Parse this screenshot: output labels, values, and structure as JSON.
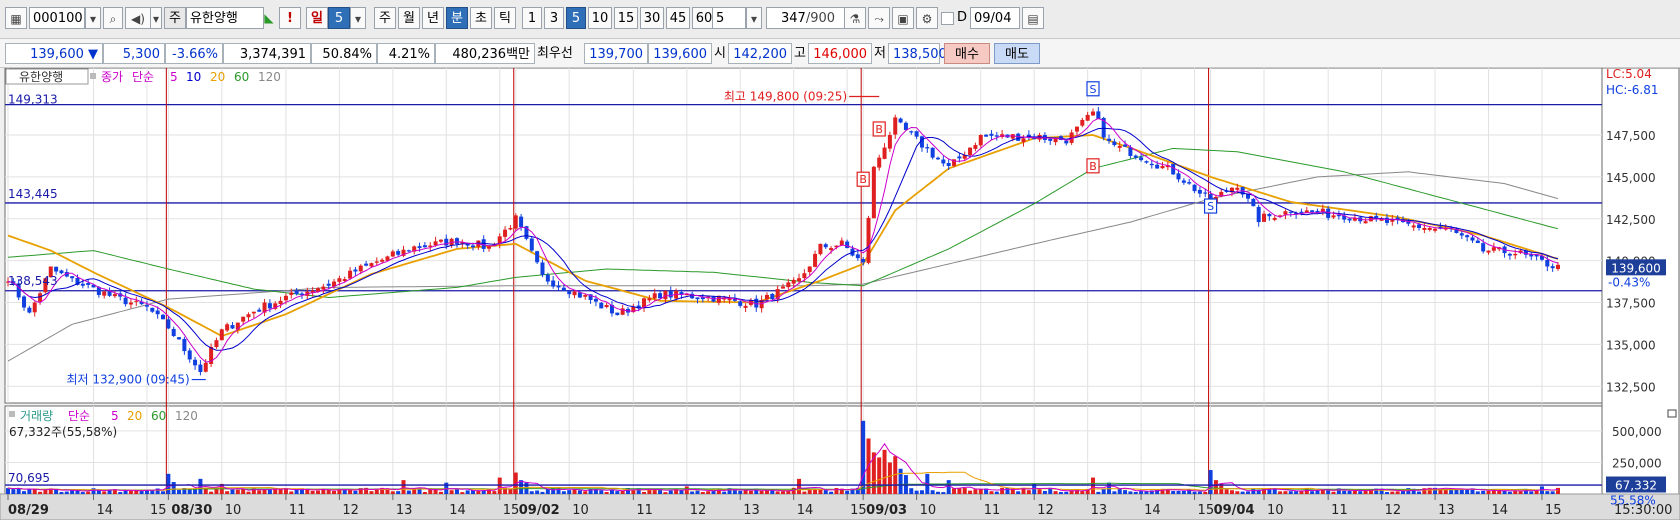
{
  "toolbar": {
    "code": "000100",
    "type_badge": "주",
    "stock_name": "유한양행",
    "alert_label": "!",
    "day_label": "일",
    "day_value": "5",
    "week_label": "주",
    "month_label": "월",
    "year_label": "년",
    "minute_label": "분",
    "second_label": "초",
    "tick_label": "틱",
    "intervals": [
      "1",
      "3",
      "5",
      "10",
      "15",
      "30",
      "45",
      "60"
    ],
    "selected_interval": "5",
    "interval_value": "5",
    "count_value": "347",
    "count_total": "/900",
    "d_label": "D",
    "date_value": "09/04"
  },
  "quote": {
    "price": "139,600 ▼",
    "change": "5,300",
    "change_pct": "-3.66%",
    "volume": "3,374,391",
    "volume_ratio": "50.84%",
    "turnover": "4.21%",
    "amount": "480,236백만",
    "best_label": "최우선",
    "best_ask": "139,700",
    "best_bid": "139,600",
    "open_label": "시",
    "open_value": "142,200",
    "high_label": "고",
    "high_value": "146,000",
    "low_label": "저",
    "low_value": "138,500",
    "buy_button": "매수",
    "sell_button": "매도"
  },
  "colors": {
    "up": "#e02020",
    "down": "#1040e0",
    "ma5": "#cc00cc",
    "ma10": "#0000cc",
    "ma20": "#e8a000",
    "ma60": "#2a9a2a",
    "ma120": "#888888",
    "ref_line": "#1a1aa8",
    "day_line": "#c00000"
  },
  "chart_data": [
    {
      "type": "candlestick",
      "legend": {
        "name": "유한양행",
        "series": "종가",
        "method": "단순",
        "periods": [
          "5",
          "10",
          "20",
          "60",
          "120"
        ]
      },
      "ylim": [
        131500,
        151500
      ],
      "y_ticks": [
        "147,500",
        "145,000",
        "142,500",
        "140,000",
        "137,500",
        "135,000",
        "132,500"
      ],
      "y_tick_values": [
        147500,
        145000,
        142500,
        140000,
        137500,
        135000,
        132500
      ],
      "ref_lines": [
        {
          "label": "149,313",
          "value": 149313
        },
        {
          "label": "143,445",
          "value": 143445
        },
        {
          "label": "138,543",
          "value": 138200
        }
      ],
      "annotations": {
        "high": "최고 149,800 (09:25)",
        "high_value": 149800,
        "low": "최저 132,900 (09:45)",
        "low_value": 132900,
        "lc": "LC:5.04",
        "hc": "HC:-6.81",
        "current_price": "139,600",
        "current_value": 139600,
        "current_pct": "-0.43%"
      },
      "signals": [
        {
          "label": "B",
          "index": 160,
          "value": 144800
        },
        {
          "label": "B",
          "index": 163,
          "value": 147800
        },
        {
          "label": "S",
          "index": 203,
          "value": 150200
        },
        {
          "label": "B",
          "index": 203,
          "value": 145600
        },
        {
          "label": "S",
          "index": 225,
          "value": 143200
        }
      ],
      "day_break_indices": [
        30,
        95,
        160,
        225
      ],
      "time_labels": [
        "08/29",
        "14",
        "15",
        "08/30",
        "10",
        "11",
        "12",
        "13",
        "14",
        "15",
        "09/02",
        "10",
        "11",
        "12",
        "13",
        "14",
        "15",
        "09/03",
        "10",
        "11",
        "12",
        "13",
        "14",
        "15",
        "09/04",
        "10",
        "11",
        "12",
        "13",
        "14",
        "15"
      ],
      "time_label_indices": [
        0,
        16,
        26,
        30,
        40,
        52,
        62,
        72,
        82,
        92,
        95,
        105,
        117,
        127,
        137,
        147,
        157,
        160,
        170,
        182,
        192,
        202,
        212,
        222,
        225,
        235,
        247,
        257,
        267,
        277,
        287
      ],
      "time_label_dates": [
        true,
        false,
        false,
        true,
        false,
        false,
        false,
        false,
        false,
        false,
        true,
        false,
        false,
        false,
        false,
        false,
        false,
        true,
        false,
        false,
        false,
        false,
        false,
        false,
        true,
        false,
        false,
        false,
        false,
        false,
        false
      ],
      "time_end_label": "15:30:00",
      "close_anchors": [
        [
          0,
          139000
        ],
        [
          4,
          136800
        ],
        [
          8,
          139500
        ],
        [
          12,
          138800
        ],
        [
          20,
          137800
        ],
        [
          26,
          137200
        ],
        [
          30,
          136000
        ],
        [
          36,
          133400
        ],
        [
          40,
          135800
        ],
        [
          46,
          137000
        ],
        [
          52,
          137800
        ],
        [
          60,
          138600
        ],
        [
          68,
          139800
        ],
        [
          76,
          140800
        ],
        [
          84,
          141200
        ],
        [
          90,
          140800
        ],
        [
          95,
          142500
        ],
        [
          100,
          139000
        ],
        [
          108,
          137800
        ],
        [
          114,
          136800
        ],
        [
          122,
          138000
        ],
        [
          132,
          137800
        ],
        [
          140,
          137400
        ],
        [
          148,
          138800
        ],
        [
          152,
          140800
        ],
        [
          156,
          141000
        ],
        [
          160,
          139800
        ],
        [
          162,
          145500
        ],
        [
          166,
          148300
        ],
        [
          172,
          146600
        ],
        [
          176,
          145500
        ],
        [
          182,
          147400
        ],
        [
          192,
          147400
        ],
        [
          198,
          147200
        ],
        [
          203,
          148800
        ],
        [
          206,
          147000
        ],
        [
          212,
          146200
        ],
        [
          218,
          145300
        ],
        [
          225,
          143500
        ],
        [
          230,
          144600
        ],
        [
          234,
          142500
        ],
        [
          240,
          143000
        ],
        [
          250,
          142700
        ],
        [
          260,
          142200
        ],
        [
          270,
          141800
        ],
        [
          276,
          140600
        ],
        [
          282,
          140500
        ],
        [
          287,
          139900
        ],
        [
          290,
          139600
        ]
      ],
      "ma20_anchors": [
        [
          0,
          141500
        ],
        [
          8,
          140600
        ],
        [
          16,
          139300
        ],
        [
          30,
          137200
        ],
        [
          40,
          135500
        ],
        [
          52,
          136800
        ],
        [
          68,
          139200
        ],
        [
          84,
          140700
        ],
        [
          95,
          141000
        ],
        [
          108,
          138800
        ],
        [
          122,
          137600
        ],
        [
          140,
          137500
        ],
        [
          152,
          138800
        ],
        [
          160,
          139800
        ],
        [
          166,
          143000
        ],
        [
          176,
          145500
        ],
        [
          192,
          147300
        ],
        [
          203,
          147500
        ],
        [
          212,
          146500
        ],
        [
          225,
          145000
        ],
        [
          240,
          143500
        ],
        [
          260,
          142600
        ],
        [
          276,
          141500
        ],
        [
          290,
          140100
        ]
      ],
      "ma60_anchors": [
        [
          0,
          140200
        ],
        [
          16,
          140600
        ],
        [
          30,
          139500
        ],
        [
          46,
          138300
        ],
        [
          60,
          137800
        ],
        [
          84,
          138400
        ],
        [
          95,
          139000
        ],
        [
          112,
          139500
        ],
        [
          132,
          139300
        ],
        [
          150,
          138700
        ],
        [
          160,
          138500
        ],
        [
          176,
          140700
        ],
        [
          192,
          143400
        ],
        [
          203,
          145500
        ],
        [
          218,
          146700
        ],
        [
          230,
          146500
        ],
        [
          250,
          145300
        ],
        [
          270,
          143600
        ],
        [
          290,
          141900
        ]
      ],
      "ma120_anchors": [
        [
          0,
          134000
        ],
        [
          12,
          136200
        ],
        [
          30,
          137700
        ],
        [
          60,
          138400
        ],
        [
          95,
          138500
        ],
        [
          120,
          138500
        ],
        [
          150,
          138500
        ],
        [
          160,
          138600
        ],
        [
          176,
          139800
        ],
        [
          192,
          141000
        ],
        [
          210,
          142300
        ],
        [
          225,
          143700
        ],
        [
          245,
          145000
        ],
        [
          262,
          145300
        ],
        [
          280,
          144600
        ],
        [
          290,
          143700
        ]
      ]
    },
    {
      "type": "bar",
      "legend": {
        "name": "거래량",
        "method": "단순",
        "periods": [
          "5",
          "20",
          "60",
          "120"
        ]
      },
      "current_volume": "67,332주(55,58%)",
      "ylim": [
        0,
        650000
      ],
      "y_ticks": [
        "500,000",
        "250,000"
      ],
      "y_tick_values": [
        500000,
        250000
      ],
      "ref_label": "70,695",
      "ref_value": 70695,
      "current_label": "67,332",
      "current_label_value": 67332,
      "pct_label": "55.58%",
      "spikes": [
        [
          30,
          160000
        ],
        [
          31,
          95000
        ],
        [
          36,
          120000
        ],
        [
          40,
          80000
        ],
        [
          74,
          110000
        ],
        [
          82,
          90000
        ],
        [
          92,
          130000
        ],
        [
          95,
          170000
        ],
        [
          96,
          110000
        ],
        [
          97,
          90000
        ],
        [
          127,
          60000
        ],
        [
          148,
          120000
        ],
        [
          160,
          580000
        ],
        [
          161,
          440000
        ],
        [
          162,
          330000
        ],
        [
          163,
          290000
        ],
        [
          164,
          350000
        ],
        [
          165,
          250000
        ],
        [
          166,
          300000
        ],
        [
          167,
          200000
        ],
        [
          168,
          150000
        ],
        [
          172,
          160000
        ],
        [
          176,
          110000
        ],
        [
          192,
          80000
        ],
        [
          203,
          130000
        ],
        [
          206,
          90000
        ],
        [
          225,
          190000
        ],
        [
          226,
          110000
        ],
        [
          227,
          80000
        ],
        [
          287,
          60000
        ]
      ]
    }
  ]
}
